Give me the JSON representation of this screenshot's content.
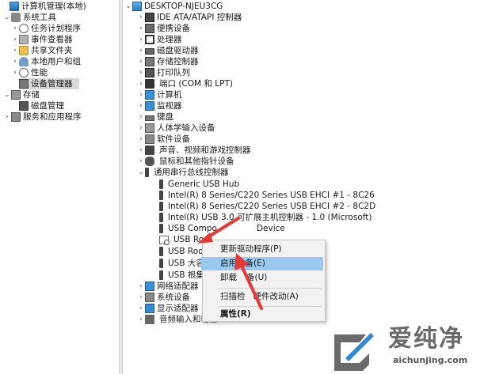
{
  "left_tree": [
    {
      "label": "计算机管理(本地)",
      "icon": "computer-icon"
    },
    {
      "label": "系统工具",
      "icon": "tools-icon",
      "expanded": true
    },
    {
      "label": "任务计划程序",
      "icon": "clock-icon"
    },
    {
      "label": "事件查看器",
      "icon": "event-log-icon"
    },
    {
      "label": "共享文件夹",
      "icon": "folder-icon"
    },
    {
      "label": "本地用户和组",
      "icon": "users-icon"
    },
    {
      "label": "性能",
      "icon": "performance-icon"
    },
    {
      "label": "设备管理器",
      "icon": "device-manager-icon",
      "selected": true
    },
    {
      "label": "存储",
      "icon": "storage-icon",
      "expanded": true
    },
    {
      "label": "磁盘管理",
      "icon": "disk-icon"
    },
    {
      "label": "服务和应用程序",
      "icon": "services-icon"
    }
  ],
  "right_tree": {
    "root": "DESKTOP-NJEU3CG",
    "categories": [
      "IDE ATA/ATAPI 控制器",
      "便携设备",
      "处理器",
      "磁盘驱动器",
      "存储控制器",
      "打印队列",
      "端口 (COM 和 LPT)",
      "计算机",
      "监视器",
      "键盘",
      "人体学输入设备",
      "软件设备",
      "声音、视频和游戏控制器",
      "鼠标和其他指针设备",
      "通用串行总线控制器"
    ],
    "usb_children": [
      "Generic USB Hub",
      "Intel(R) 8 Series/C220 Series USB EHCI #1 - 8C26",
      "Intel(R) 8 Series/C220 Series USB EHCI #2 - 8C2D",
      "Intel(R) USB 3.0 可扩展主机控制器 - 1.0 (Microsoft)",
      "USB Composite Device",
      "USB Root Hub",
      "USB Root Hub",
      "USB 大容量存储设备",
      "USB 根集线器(USB 3.0)"
    ],
    "usb_children_visible": [
      "Generic USB Hub",
      "Intel(R) 8 Series/C220 Series USB EHCI #1 - 8C26",
      "Intel(R) 8 Series/C220 Series USB EHCI #2 - 8C2D",
      "Intel(R) USB 3.0 可扩",
      "USB Compo",
      "USB Roo",
      "USB Roo",
      "USB 大容",
      "USB 根集"
    ],
    "usb_partial_tail": {
      "intel30": "展主机控制器 - 1.0 (Microsoft)",
      "composite": "Device"
    },
    "more_categories": [
      "网络适配器",
      "系统设备",
      "显示适配器",
      "音频输入和输出"
    ]
  },
  "context_menu": {
    "items": [
      {
        "label": "更新驱动程序(P)"
      },
      {
        "label": "启用设备(E)",
        "active": true
      },
      {
        "label": "卸载设备(U)",
        "visible": "卸载"
      },
      {
        "label": "扫描检测硬件改动(A)"
      },
      {
        "label": "属性(R)",
        "bold": true
      }
    ],
    "uninstall_tail": "备(U)",
    "scan_head": "扫描检",
    "scan_tail": "硬件改动(A)"
  },
  "watermark": {
    "brand": "爱纯净",
    "url": "aichunjing.com"
  },
  "colors": {
    "selection": "#99c9ef",
    "arrow": "#e53935",
    "tree_selected": "#d9d9d9"
  }
}
